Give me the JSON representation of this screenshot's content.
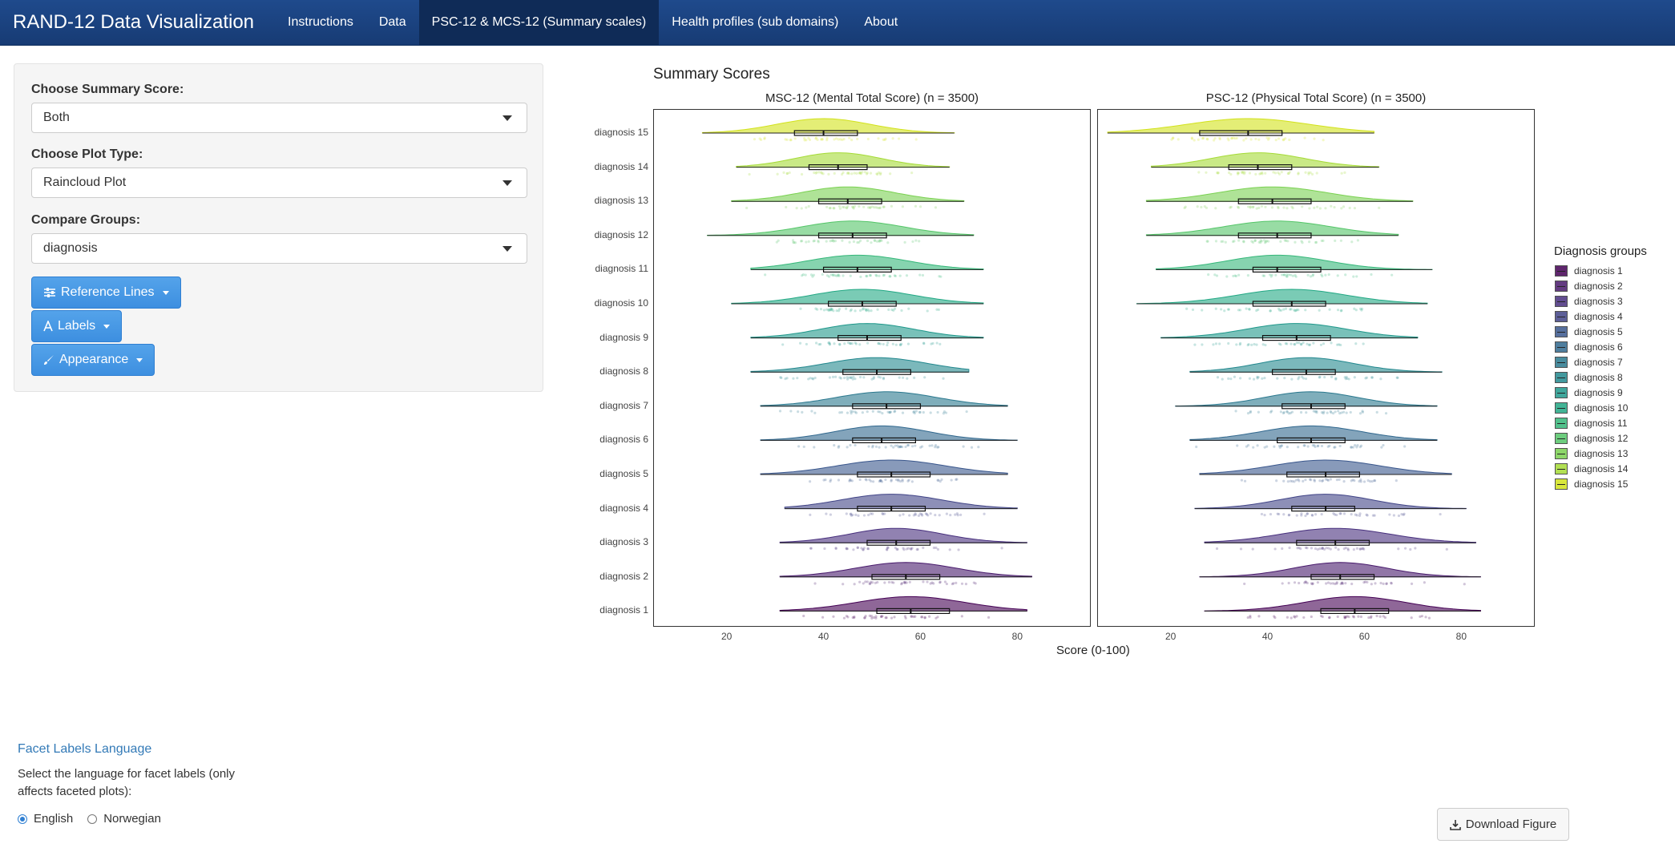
{
  "navbar": {
    "brand": "RAND-12 Data Visualization",
    "tabs": [
      {
        "label": "Instructions",
        "active": false
      },
      {
        "label": "Data",
        "active": false
      },
      {
        "label": "PSC-12 & MCS-12 (Summary scales)",
        "active": true
      },
      {
        "label": "Health profiles (sub domains)",
        "active": false
      },
      {
        "label": "About",
        "active": false
      }
    ]
  },
  "sidebar": {
    "summary_label": "Choose Summary Score:",
    "summary_value": "Both",
    "plot_type_label": "Choose Plot Type:",
    "plot_type_value": "Raincloud Plot",
    "compare_label": "Compare Groups:",
    "compare_value": "diagnosis",
    "reference_lines_label": "Reference Lines",
    "labels_label": "Labels",
    "appearance_label": "Appearance"
  },
  "facet_language": {
    "heading": "Facet Labels Language",
    "help": "Select the language for facet labels (only affects faceted plots):",
    "options": [
      "English",
      "Norwegian"
    ],
    "selected": "English"
  },
  "download_label": "Download Figure",
  "chart_data": {
    "type": "raincloud",
    "title": "Summary Scores",
    "xlabel": "Score (0-100)",
    "xlim": [
      5,
      95
    ],
    "xticks": [
      20,
      40,
      60,
      80
    ],
    "legend": {
      "title": "Diagnosis groups",
      "placement": "right"
    },
    "colors": [
      "#440154",
      "#481a6c",
      "#472f7d",
      "#414487",
      "#39568c",
      "#31688e",
      "#2a788e",
      "#23888e",
      "#1f988b",
      "#22a884",
      "#35b779",
      "#54c568",
      "#7ad151",
      "#a5db36",
      "#d2e21b"
    ],
    "categories": [
      "diagnosis 1",
      "diagnosis 2",
      "diagnosis 3",
      "diagnosis 4",
      "diagnosis 5",
      "diagnosis 6",
      "diagnosis 7",
      "diagnosis 8",
      "diagnosis 9",
      "diagnosis 10",
      "diagnosis 11",
      "diagnosis 12",
      "diagnosis 13",
      "diagnosis 14",
      "diagnosis 15"
    ],
    "panels": [
      {
        "name": "MSC-12 (Mental Total Score) (n = 3500)",
        "series": [
          {
            "min": 31,
            "q1": 51,
            "median": 58,
            "q3": 66,
            "max": 82
          },
          {
            "min": 31,
            "q1": 50,
            "median": 57,
            "q3": 64,
            "max": 83
          },
          {
            "min": 31,
            "q1": 49,
            "median": 55,
            "q3": 62,
            "max": 82
          },
          {
            "min": 32,
            "q1": 47,
            "median": 54,
            "q3": 61,
            "max": 80
          },
          {
            "min": 27,
            "q1": 47,
            "median": 54,
            "q3": 62,
            "max": 78
          },
          {
            "min": 27,
            "q1": 46,
            "median": 52,
            "q3": 59,
            "max": 80
          },
          {
            "min": 27,
            "q1": 46,
            "median": 53,
            "q3": 60,
            "max": 78
          },
          {
            "min": 25,
            "q1": 44,
            "median": 51,
            "q3": 58,
            "max": 70
          },
          {
            "min": 25,
            "q1": 43,
            "median": 49,
            "q3": 56,
            "max": 73
          },
          {
            "min": 21,
            "q1": 41,
            "median": 48,
            "q3": 55,
            "max": 73
          },
          {
            "min": 25,
            "q1": 40,
            "median": 47,
            "q3": 54,
            "max": 73
          },
          {
            "min": 16,
            "q1": 39,
            "median": 46,
            "q3": 53,
            "max": 71
          },
          {
            "min": 21,
            "q1": 39,
            "median": 45,
            "q3": 52,
            "max": 69
          },
          {
            "min": 22,
            "q1": 37,
            "median": 43,
            "q3": 49,
            "max": 66
          },
          {
            "min": 15,
            "q1": 34,
            "median": 40,
            "q3": 47,
            "max": 67
          }
        ]
      },
      {
        "name": "PSC-12 (Physical Total Score) (n = 3500)",
        "series": [
          {
            "min": 27,
            "q1": 51,
            "median": 58,
            "q3": 65,
            "max": 84
          },
          {
            "min": 26,
            "q1": 49,
            "median": 55,
            "q3": 62,
            "max": 84
          },
          {
            "min": 27,
            "q1": 46,
            "median": 54,
            "q3": 61,
            "max": 83
          },
          {
            "min": 25,
            "q1": 45,
            "median": 52,
            "q3": 58,
            "max": 81
          },
          {
            "min": 26,
            "q1": 44,
            "median": 52,
            "q3": 59,
            "max": 78
          },
          {
            "min": 24,
            "q1": 42,
            "median": 49,
            "q3": 56,
            "max": 75
          },
          {
            "min": 21,
            "q1": 43,
            "median": 49,
            "q3": 56,
            "max": 75
          },
          {
            "min": 24,
            "q1": 41,
            "median": 48,
            "q3": 54,
            "max": 76
          },
          {
            "min": 18,
            "q1": 39,
            "median": 46,
            "q3": 53,
            "max": 71
          },
          {
            "min": 13,
            "q1": 37,
            "median": 45,
            "q3": 52,
            "max": 73
          },
          {
            "min": 17,
            "q1": 37,
            "median": 42,
            "q3": 51,
            "max": 74
          },
          {
            "min": 15,
            "q1": 34,
            "median": 42,
            "q3": 49,
            "max": 67
          },
          {
            "min": 15,
            "q1": 34,
            "median": 41,
            "q3": 49,
            "max": 70
          },
          {
            "min": 16,
            "q1": 32,
            "median": 38,
            "q3": 45,
            "max": 63
          },
          {
            "min": 7,
            "q1": 26,
            "median": 36,
            "q3": 43,
            "max": 62
          }
        ]
      }
    ]
  }
}
